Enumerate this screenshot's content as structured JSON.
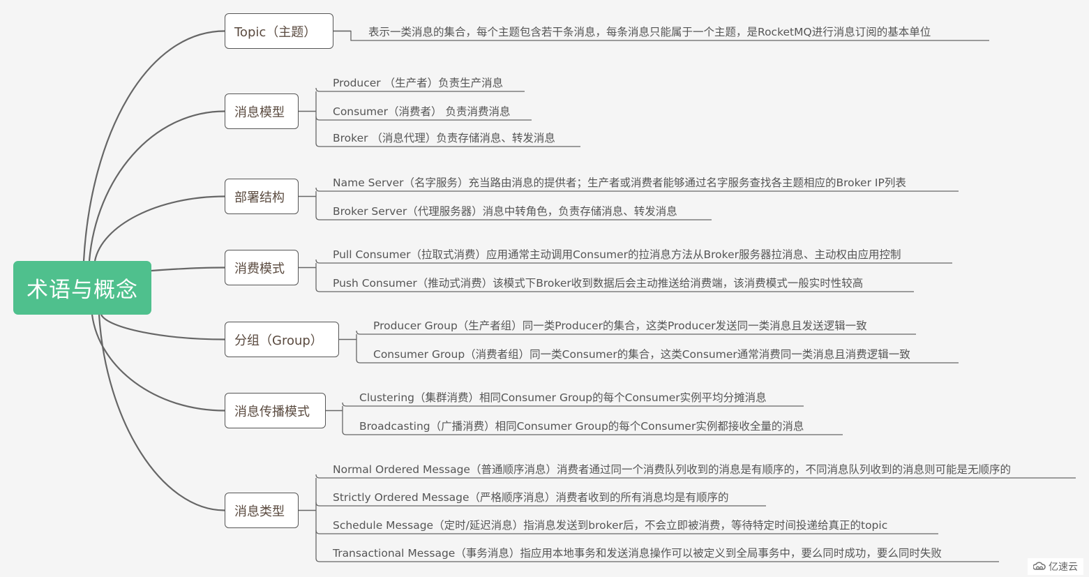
{
  "root": {
    "label": "术语与概念",
    "color": "#4fc08d"
  },
  "branches": [
    {
      "label": "Topic（主题）",
      "children": [
        "表示一类消息的集合，每个主题包含若干条消息，每条消息只能属于一个主题，是RocketMQ进行消息订阅的基本单位"
      ]
    },
    {
      "label": "消息模型",
      "children": [
        "Producer （生产者）负责生产消息",
        "Consumer（消费者） 负责消费消息",
        "Broker （消息代理）负责存储消息、转发消息"
      ]
    },
    {
      "label": "部署结构",
      "children": [
        "Name Server（名字服务）充当路由消息的提供者；生产者或消费者能够通过名字服务查找各主题相应的Broker IP列表",
        "Broker Server（代理服务器）消息中转角色，负责存储消息、转发消息"
      ]
    },
    {
      "label": "消费模式",
      "children": [
        "Pull Consumer（拉取式消费）应用通常主动调用Consumer的拉消息方法从Broker服务器拉消息、主动权由应用控制",
        "Push Consumer（推动式消费）该模式下Broker收到数据后会主动推送给消费端，该消费模式一般实时性较高"
      ]
    },
    {
      "label": "分组（Group）",
      "children": [
        "Producer Group（生产者组）同一类Producer的集合，这类Producer发送同一类消息且发送逻辑一致",
        "Consumer Group（消费者组）同一类Consumer的集合，这类Consumer通常消费同一类消息且消费逻辑一致"
      ]
    },
    {
      "label": "消息传播模式",
      "children": [
        "Clustering（集群消费）相同Consumer Group的每个Consumer实例平均分摊消息",
        "Broadcasting（广播消费）相同Consumer Group的每个Consumer实例都接收全量的消息"
      ]
    },
    {
      "label": "消息类型",
      "children": [
        "Normal Ordered Message（普通顺序消息）消费者通过同一个消费队列收到的消息是有顺序的，不同消息队列收到的消息则可能是无顺序的",
        "Strictly Ordered Message（严格顺序消息）消费者收到的所有消息均是有顺序的",
        "Schedule Message（定时/延迟消息）指消息发送到broker后，不会立即被消费，等待特定时间投递给真正的topic",
        "Transactional Message（事务消息）指应用本地事务和发送消息操作可以被定义到全局事务中，要么同时成功，要么同时失败"
      ]
    }
  ],
  "watermark": {
    "icon": "cloud-logo-icon",
    "text": "亿速云"
  },
  "colors": {
    "line": "#666666",
    "node_text": "#5a4a3f",
    "leaf_text": "#555555",
    "background": "#f5f5f5"
  }
}
